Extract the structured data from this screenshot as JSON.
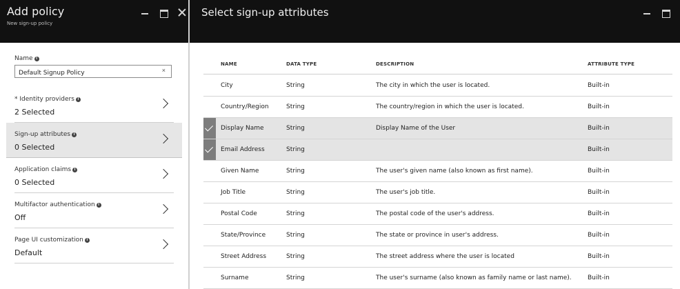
{
  "left_blade": {
    "title": "Add policy",
    "subtitle": "New sign-up policy",
    "name_label": "Name",
    "name_value": "Default Signup Policy",
    "clear_glyph": "×",
    "items": [
      {
        "label": "* Identity providers",
        "value": "2 Selected"
      },
      {
        "label": "Sign-up attributes",
        "value": "0 Selected"
      },
      {
        "label": "Application claims",
        "value": "0 Selected"
      },
      {
        "label": "Multifactor authentication",
        "value": "Off"
      },
      {
        "label": "Page UI customization",
        "value": "Default"
      }
    ],
    "active_item": "Sign-up attributes"
  },
  "right_blade": {
    "title": "Select sign-up attributes",
    "columns": {
      "name": "NAME",
      "type": "DATA TYPE",
      "desc": "DESCRIPTION",
      "attr": "ATTRIBUTE TYPE"
    },
    "rows": [
      {
        "name": "City",
        "type": "String",
        "desc": "The city in which the user is located.",
        "attr": "Built-in",
        "selected": false
      },
      {
        "name": "Country/Region",
        "type": "String",
        "desc": "The country/region in which the user is located.",
        "attr": "Built-in",
        "selected": false
      },
      {
        "name": "Display Name",
        "type": "String",
        "desc": "Display Name of the User",
        "attr": "Built-in",
        "selected": true
      },
      {
        "name": "Email Address",
        "type": "String",
        "desc": "",
        "attr": "Built-in",
        "selected": true
      },
      {
        "name": "Given Name",
        "type": "String",
        "desc": "The user's given name (also known as first name).",
        "attr": "Built-in",
        "selected": false
      },
      {
        "name": "Job Title",
        "type": "String",
        "desc": "The user's job title.",
        "attr": "Built-in",
        "selected": false
      },
      {
        "name": "Postal Code",
        "type": "String",
        "desc": "The postal code of the user's address.",
        "attr": "Built-in",
        "selected": false
      },
      {
        "name": "State/Province",
        "type": "String",
        "desc": "The state or province in user's address.",
        "attr": "Built-in",
        "selected": false
      },
      {
        "name": "Street Address",
        "type": "String",
        "desc": "The street address where the user is located",
        "attr": "Built-in",
        "selected": false
      },
      {
        "name": "Surname",
        "type": "String",
        "desc": "The user's surname (also known as family name or last name).",
        "attr": "Built-in",
        "selected": false
      }
    ]
  },
  "icons": {
    "info": "info-icon",
    "chevron": "chevron-right-icon",
    "check": "checkmark-icon",
    "minimize": "minimize-icon",
    "maximize": "maximize-icon",
    "close": "close-icon"
  },
  "colors": {
    "header_bg": "#111111",
    "selected_row_bg": "#e4e4e4",
    "check_cell_bg": "#7d7d7d",
    "active_item_bg": "#e6e6e6"
  }
}
